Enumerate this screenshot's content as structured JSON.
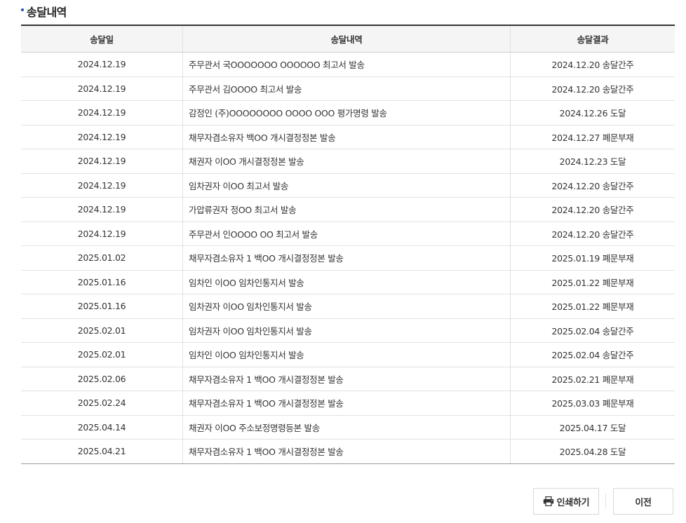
{
  "section": {
    "title": "송달내역"
  },
  "table": {
    "headers": {
      "date": "송달일",
      "content": "송달내역",
      "result": "송달결과"
    },
    "rows": [
      {
        "date": "2024.12.19",
        "content": "주무관서 국OOOOOOO OOOOOO 최고서 발송",
        "result": "2024.12.20 송달간주"
      },
      {
        "date": "2024.12.19",
        "content": "주무관서 김OOOO 최고서 발송",
        "result": "2024.12.20 송달간주"
      },
      {
        "date": "2024.12.19",
        "content": "감정인 (주)OOOOOOOO OOOO OOO 평가명령 발송",
        "result": "2024.12.26 도달"
      },
      {
        "date": "2024.12.19",
        "content": "채무자겸소유자 백OO 개시결정정본 발송",
        "result": "2024.12.27 폐문부재"
      },
      {
        "date": "2024.12.19",
        "content": "채권자 이OO 개시결정정본 발송",
        "result": "2024.12.23 도달"
      },
      {
        "date": "2024.12.19",
        "content": "임차권자 이OO 최고서 발송",
        "result": "2024.12.20 송달간주"
      },
      {
        "date": "2024.12.19",
        "content": "가압류권자 정OO 최고서 발송",
        "result": "2024.12.20 송달간주"
      },
      {
        "date": "2024.12.19",
        "content": "주무관서 인OOOO OO 최고서 발송",
        "result": "2024.12.20 송달간주"
      },
      {
        "date": "2025.01.02",
        "content": "채무자겸소유자 1 백OO 개시결정정본 발송",
        "result": "2025.01.19 폐문부재"
      },
      {
        "date": "2025.01.16",
        "content": "임차인 이OO 임차인통지서 발송",
        "result": "2025.01.22 폐문부재"
      },
      {
        "date": "2025.01.16",
        "content": "임차권자 이OO 임차인통지서 발송",
        "result": "2025.01.22 폐문부재"
      },
      {
        "date": "2025.02.01",
        "content": "임차권자 이OO 임차인통지서 발송",
        "result": "2025.02.04 송달간주"
      },
      {
        "date": "2025.02.01",
        "content": "임차인 이OO 임차인통지서 발송",
        "result": "2025.02.04 송달간주"
      },
      {
        "date": "2025.02.06",
        "content": "채무자겸소유자 1 백OO 개시결정정본 발송",
        "result": "2025.02.21 폐문부재"
      },
      {
        "date": "2025.02.24",
        "content": "채무자겸소유자 1 백OO 개시결정정본 발송",
        "result": "2025.03.03 폐문부재"
      },
      {
        "date": "2025.04.14",
        "content": "채권자 이OO 주소보정명령등본 발송",
        "result": "2025.04.17 도달"
      },
      {
        "date": "2025.04.21",
        "content": "채무자겸소유자 1 백OO 개시결정정본 발송",
        "result": "2025.04.28 도달"
      }
    ]
  },
  "buttons": {
    "print_label": "인쇄하기",
    "print_icon": "printer-icon",
    "prev_label": "이전"
  }
}
